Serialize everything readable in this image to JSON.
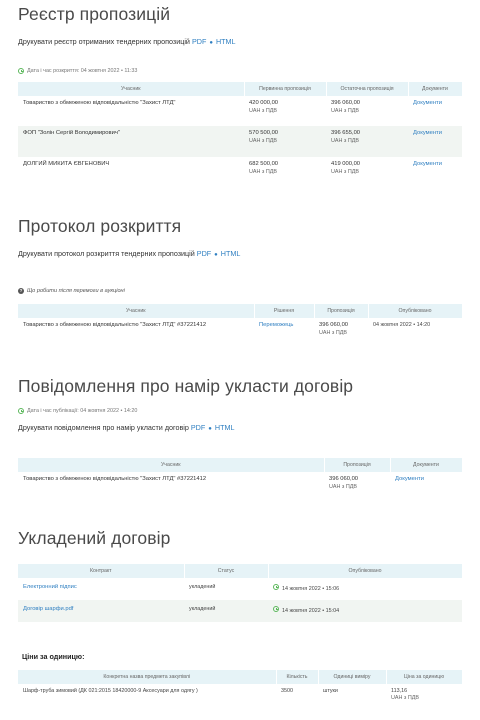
{
  "registry": {
    "title": "Реєстр пропозицій",
    "print_text": "Друкувати реєстр отриманих тендерних пропозицій",
    "pdf": "PDF",
    "html": "HTML",
    "opened": "Дата і час розкриття: 04 жовтня 2022  •  11:33",
    "headers": [
      "Учасник",
      "Первинна пропозиція",
      "Остаточна пропозиція",
      "Документи"
    ],
    "rows": [
      {
        "participant": "Товариство з обмеженою відповідальністю \"Захист ЛТД\"",
        "initial": "420 000,00",
        "initial_vat": "UAH з ПДВ",
        "final": "396 060,00",
        "final_vat": "UAH з ПДВ",
        "docs": "Документи"
      },
      {
        "participant": "ФОП \"Золін Сергій Володимирович\"",
        "initial": "570 500,00",
        "initial_vat": "UAH з ПДВ",
        "final": "396 655,00",
        "final_vat": "UAH з ПДВ",
        "docs": "Документи"
      },
      {
        "participant": "ДОЛГИЙ МИКИТА ЄВГЕНОВИЧ",
        "initial": "682 500,00",
        "initial_vat": "UAH з ПДВ",
        "final": "419 000,00",
        "final_vat": "UAH з ПДВ",
        "docs": "Документи"
      }
    ]
  },
  "protocol": {
    "title": "Протокол розкриття",
    "print_text": "Друкувати протокол розкриття тендерних пропозицій",
    "pdf": "PDF",
    "html": "HTML",
    "note": "Що робити після перемоги в аукціоні",
    "headers": [
      "Учасник",
      "Рішення",
      "Пропозиція",
      "Опубліковано"
    ],
    "row": {
      "participant": "Товариство з обмеженою відповідальністю \"Захист ЛТД\" #37221412",
      "decision": "Переможець",
      "offer": "396 060,00",
      "offer_vat": "UAH з ПДВ",
      "published": "04 жовтня 2022   •   14:20"
    }
  },
  "notice": {
    "title": "Повідомлення про намір укласти договір",
    "published": "Дата і час публікації: 04 жовтня 2022   •   14:20",
    "print_text": "Друкувати повідомлення про намір укласти договір",
    "pdf": "PDF",
    "html": "HTML",
    "headers": [
      "Учасник",
      "Пропозиція",
      "Документи"
    ],
    "row": {
      "participant": "Товариство з обмеженою відповідальністю \"Захист ЛТД\" #37221412",
      "offer": "396 060,00",
      "offer_vat": "UAH з ПДВ",
      "docs": "Документи"
    }
  },
  "contract": {
    "title": "Укладений договір",
    "headers": [
      "Контракт",
      "Статус",
      "Опубліковано"
    ],
    "rows": [
      {
        "name": "Електронний підпис",
        "status": "укладений",
        "published": "14 жовтня 2022   •   15:06"
      },
      {
        "name": "Договір шарфи.pdf",
        "status": "укладений",
        "published": "14 жовтня 2022   •   15:04"
      }
    ],
    "unit_prices_label": "Ціни за одиницю:",
    "price_headers": [
      "Конкретна назва предмета закупівлі",
      "Кількість",
      "Одиниці виміру",
      "Ціна за одиницю"
    ],
    "price_row": {
      "item": "Шарф-труба зимовий (ДК 021:2015 18420000-9 Аксесуари для одягу )",
      "qty": "3500",
      "unit": "штуки",
      "price": "113,16",
      "price_vat": "UAH з ПДВ"
    }
  }
}
